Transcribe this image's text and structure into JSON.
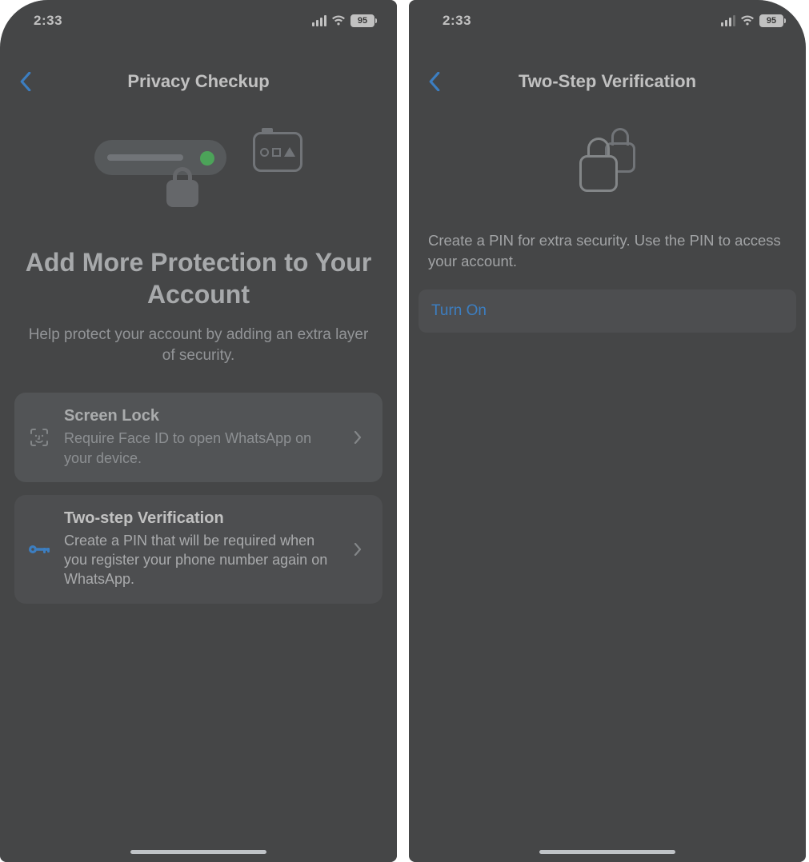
{
  "left": {
    "status": {
      "time": "2:33",
      "battery": "95"
    },
    "nav": {
      "title": "Privacy Checkup"
    },
    "headline": "Add More Protection to Your Account",
    "sub": "Help protect your account by adding an extra layer of security.",
    "cards": [
      {
        "title": "Screen Lock",
        "desc": "Require Face ID to open WhatsApp on your device."
      },
      {
        "title": "Two-step Verification",
        "desc": "Create a PIN that will be required when you register your phone number again on WhatsApp."
      }
    ]
  },
  "right": {
    "status": {
      "time": "2:33",
      "battery": "95"
    },
    "nav": {
      "title": "Two-Step Verification"
    },
    "desc": "Create a PIN for extra security. Use the PIN to access your account.",
    "action": "Turn On"
  }
}
